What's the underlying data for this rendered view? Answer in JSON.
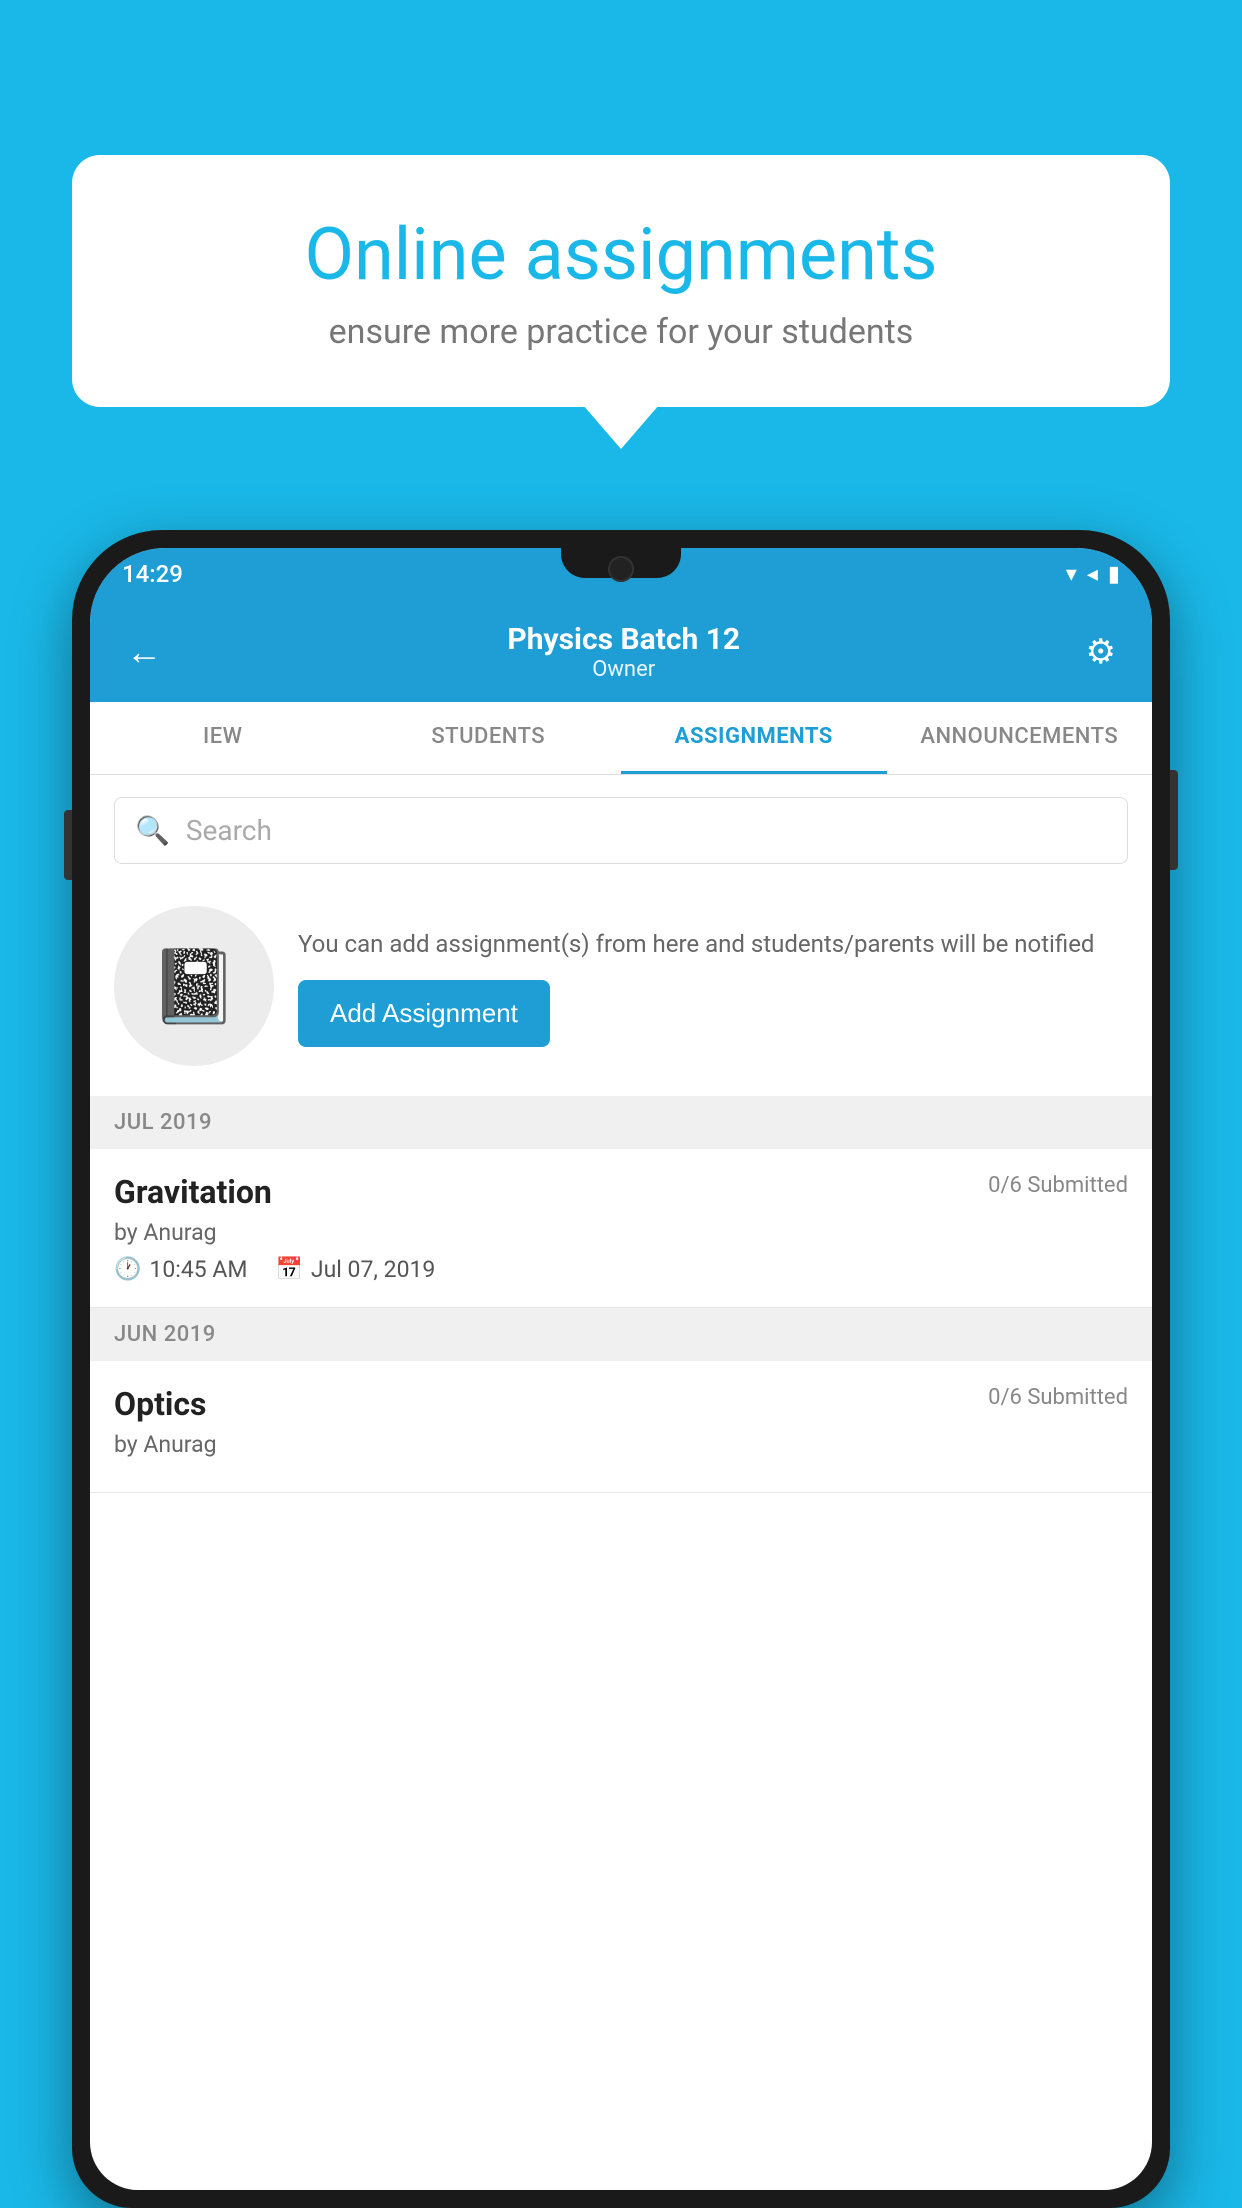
{
  "background": {
    "color": "#1ab8e8"
  },
  "speech_bubble": {
    "title": "Online assignments",
    "subtitle": "ensure more practice for your students"
  },
  "phone": {
    "status_bar": {
      "time": "14:29",
      "icons": "▾◂▮"
    },
    "header": {
      "title": "Physics Batch 12",
      "subtitle": "Owner",
      "back_icon": "←",
      "settings_icon": "⚙"
    },
    "tabs": [
      {
        "label": "IEW",
        "active": false
      },
      {
        "label": "STUDENTS",
        "active": false
      },
      {
        "label": "ASSIGNMENTS",
        "active": true
      },
      {
        "label": "ANNOUNCEMENTS",
        "active": false
      }
    ],
    "search": {
      "placeholder": "Search"
    },
    "promo": {
      "description": "You can add assignment(s) from here and students/parents will be notified",
      "button_label": "Add Assignment"
    },
    "sections": [
      {
        "header": "JUL 2019",
        "items": [
          {
            "name": "Gravitation",
            "submitted": "0/6 Submitted",
            "author": "by Anurag",
            "time": "10:45 AM",
            "date": "Jul 07, 2019"
          }
        ]
      },
      {
        "header": "JUN 2019",
        "items": [
          {
            "name": "Optics",
            "submitted": "0/6 Submitted",
            "author": "by Anurag",
            "time": "",
            "date": ""
          }
        ]
      }
    ]
  }
}
